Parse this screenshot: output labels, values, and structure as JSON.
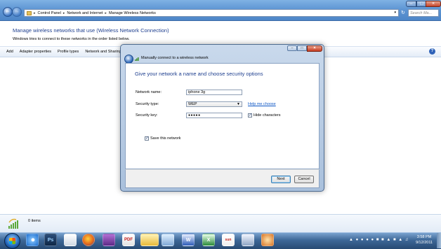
{
  "explorer": {
    "breadcrumb": [
      "Control Panel",
      "Network and Internet",
      "Manage Wireless Networks"
    ],
    "search_placeholder": "Search Ma...",
    "heading": "Manage wireless networks that use (Wireless Network Connection)",
    "subheading": "Windows tries to connect to these networks in the order listed below.",
    "toolbar": [
      "Add",
      "Adapter properties",
      "Profile types",
      "Network and Sharing"
    ],
    "items_count": "0 items"
  },
  "dialog": {
    "title": "Manually connect to a wireless network",
    "heading": "Give your network a name and choose security options",
    "network_name_label": "Network name:",
    "network_name_value": "iphone 3g",
    "security_type_label": "Security type:",
    "security_type_value": "WEP",
    "security_key_label": "Security key:",
    "security_key_value": "●●●●●",
    "help_link": "Help me choose",
    "hide_characters_label": "Hide characters",
    "hide_characters_checked": true,
    "save_network_label": "Save this network",
    "save_network_checked": true,
    "next_button": "Next",
    "cancel_button": "Cancel"
  },
  "taskbar": {
    "clock_time": "3:58 PM",
    "clock_date": "9/12/2011",
    "pinned_apps": [
      "explorer",
      "bluetooth",
      "photoshop",
      "document",
      "firefox",
      "media",
      "adobe",
      "folder",
      "dreamweaver",
      "word",
      "excel",
      "sun",
      "network",
      "paint"
    ]
  }
}
